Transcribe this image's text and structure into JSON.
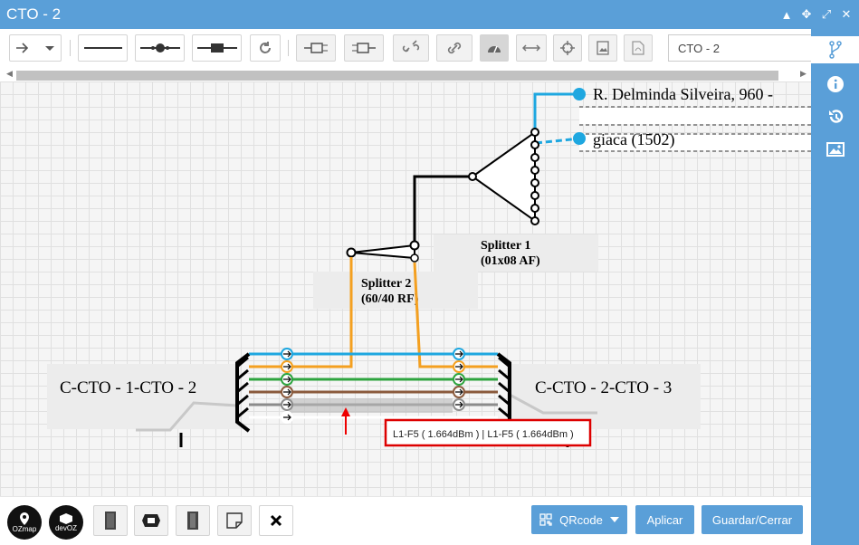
{
  "window": {
    "title": "CTO - 2"
  },
  "toolbar": {
    "name_value": "CTO - 2",
    "buttons": [
      "arrow-dropdown",
      "line",
      "splice-closure",
      "connector",
      "refresh",
      "connector-left",
      "connector-right",
      "disconnect",
      "connect",
      "speedometer",
      "expand-horizontal",
      "target",
      "image-export",
      "pdf-export"
    ]
  },
  "diagram": {
    "clients": [
      {
        "label": "R. Delminda Silveira, 960 -"
      },
      {
        "label": "giaca (1502)"
      }
    ],
    "splitter1": {
      "name": "Splitter 1",
      "type": "(01x08 AF)",
      "ports": [
        "1",
        "2",
        "3",
        "4",
        "5",
        "6",
        "7",
        "8"
      ]
    },
    "splitter2": {
      "name": "Splitter 2",
      "type": "(60/40 RF)",
      "ports": [
        "1",
        "2"
      ]
    },
    "cables": [
      {
        "label": "C-CTO - 1-CTO - 2"
      },
      {
        "label": "C-CTO - 2-CTO - 3"
      }
    ],
    "fibers": [
      {
        "color": "#1ea7e0"
      },
      {
        "color": "#f4a020"
      },
      {
        "color": "#2ea43f"
      },
      {
        "color": "#8a5a3c"
      },
      {
        "color": "#8c8c8c"
      },
      {
        "color": "#ffffff"
      }
    ],
    "tooltip": "L1-F5 ( 1.664dBm ) | L1-F5 ( 1.664dBm )"
  },
  "footer": {
    "logo1": "OZmap",
    "logo2": "devOZ",
    "qrcode_label": "QRcode",
    "apply_label": "Aplicar",
    "save_close_label": "Guardar/Cerrar"
  }
}
